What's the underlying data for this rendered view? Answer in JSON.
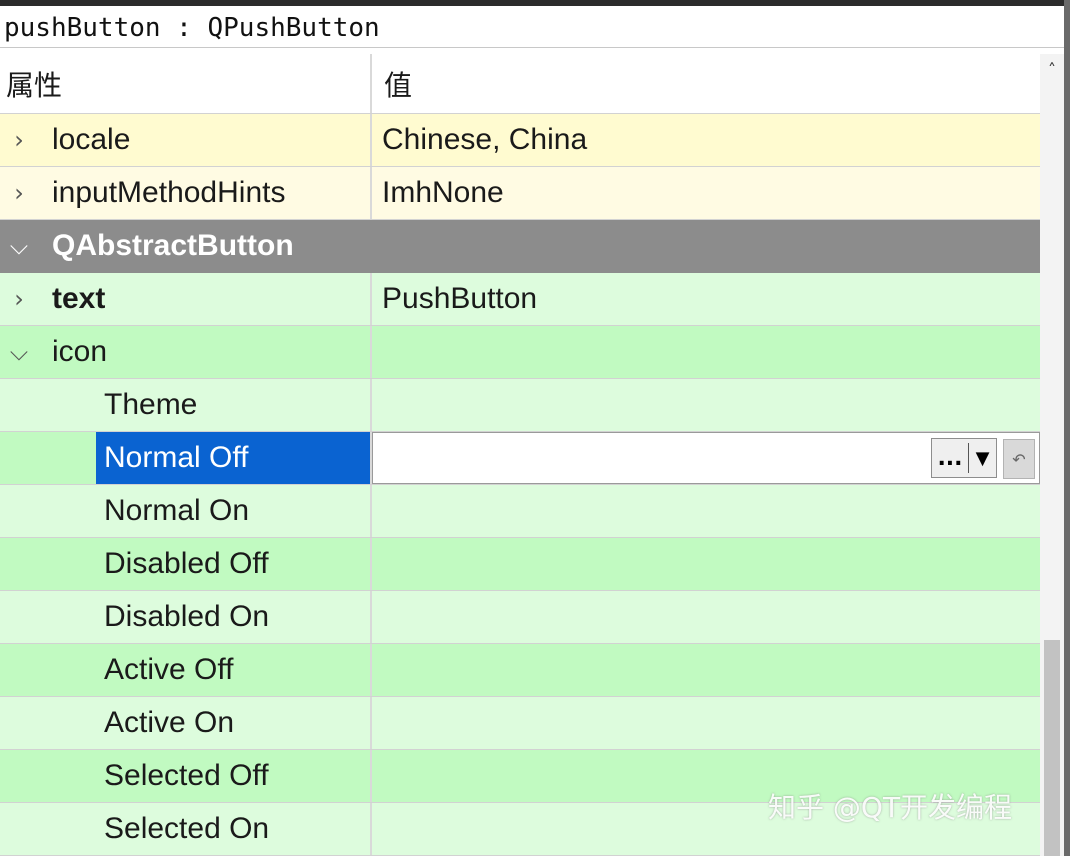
{
  "title_bar": {
    "text": "pushButton : QPushButton"
  },
  "header": {
    "property": "属性",
    "value": "值"
  },
  "rows": {
    "locale": {
      "name": "locale",
      "value": "Chinese, China"
    },
    "inputMethodHints": {
      "name": "inputMethodHints",
      "value": "ImhNone"
    },
    "group": {
      "name": "QAbstractButton"
    },
    "text": {
      "name": "text",
      "value": "PushButton"
    },
    "icon": {
      "name": "icon"
    },
    "theme": {
      "name": "Theme"
    },
    "normal_off": {
      "name": "Normal Off",
      "value": ""
    },
    "normal_on": {
      "name": "Normal On"
    },
    "disabled_off": {
      "name": "Disabled Off"
    },
    "disabled_on": {
      "name": "Disabled On"
    },
    "active_off": {
      "name": "Active Off"
    },
    "active_on": {
      "name": "Active On"
    },
    "selected_off": {
      "name": "Selected Off"
    },
    "selected_on": {
      "name": "Selected On"
    }
  },
  "editor": {
    "dots_label": "...",
    "dropdown_icon": "triangle-down-icon",
    "reset_icon": "undo-arrow-icon"
  },
  "watermark": "知乎 @QT开发编程",
  "colors": {
    "yellow_row": "#fffbd0",
    "group_row": "#8c8c8c",
    "green_light": "#ddfcdd",
    "green_dark": "#c1fac1",
    "selection": "#0a63d1"
  }
}
